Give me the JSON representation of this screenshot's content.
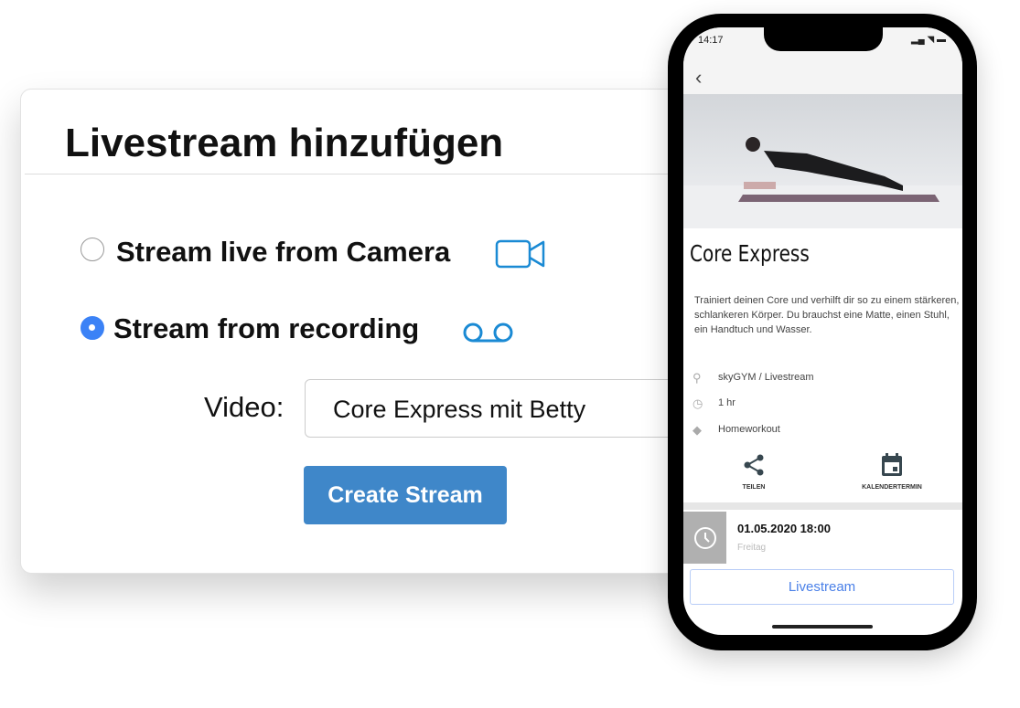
{
  "dialog": {
    "title": "Livestream hinzufügen",
    "options": [
      {
        "label": "Stream live from Camera",
        "selected": false,
        "icon": "video-camera-icon"
      },
      {
        "label": "Stream from recording",
        "selected": true,
        "icon": "voicemail-recording-icon"
      }
    ],
    "video_label": "Video:",
    "video_value": "Core Express mit Betty",
    "create_button": "Create Stream",
    "accent": "#3f87c9",
    "icon_color": "#1a8ad4"
  },
  "phone": {
    "time": "14:17",
    "title": "Core Express",
    "description": "Trainiert deinen Core und verhilft dir so zu einem stärkeren, schlankeren Körper. Du brauchst eine Matte, einen Stuhl, ein Handtuch und Wasser.",
    "location": "skyGYM / Livestream",
    "duration": "1 hr",
    "tag": "Homeworkout",
    "share_label": "TEILEN",
    "calendar_label": "KALENDERTERMIN",
    "date": "01.05.2020  18:00",
    "weekday": "Freitag",
    "livestream_button": "Livestream"
  }
}
